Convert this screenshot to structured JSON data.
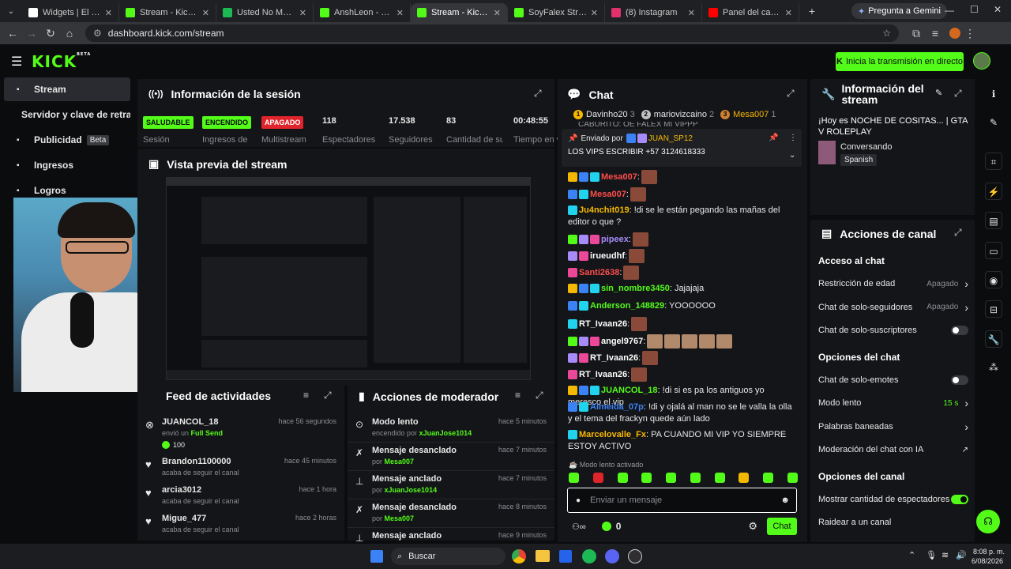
{
  "browser": {
    "tabs": [
      {
        "title": "Widgets | El mejor sof",
        "color": "#ffffff"
      },
      {
        "title": "Stream - Kick Dashbo",
        "color": "#53fc18"
      },
      {
        "title": "Usted No Me Olvid",
        "color": "#1db954"
      },
      {
        "title": "AnshLeon - Watch clip",
        "color": "#53fc18"
      },
      {
        "title": "Stream - Kick Dashbo",
        "color": "#53fc18",
        "active": true
      },
      {
        "title": "SoyFalex Stream - Wa",
        "color": "#53fc18"
      },
      {
        "title": "(8) Instagram",
        "color": "#e1306c"
      },
      {
        "title": "Panel del canal - You",
        "color": "#ff0000"
      }
    ],
    "gemini_label": "Pregunta a Gemini",
    "url": "dashboard.kick.com/stream"
  },
  "header": {
    "logo": "KICK",
    "logo_sup": "BETA",
    "start_stream": "Inicia la transmisión en directo"
  },
  "sidebar": {
    "items": [
      {
        "label": "Stream",
        "icon": "broadcast-icon"
      },
      {
        "label": "Servidor y clave de retransm",
        "icon": ""
      },
      {
        "label": "Publicidad",
        "icon": "ads-icon",
        "badge": "Beta"
      },
      {
        "label": "Ingresos",
        "icon": "chart-icon"
      },
      {
        "label": "Logros",
        "icon": "trophy-icon"
      }
    ]
  },
  "session": {
    "title": "Información de la sesión",
    "stats": [
      {
        "value": "SALUDABLE",
        "label": "Sesión",
        "color": "#53fc18"
      },
      {
        "value": "ENCENDIDO",
        "label": "Ingresos de",
        "color": "#53fc18"
      },
      {
        "value": "APAGADO",
        "label": "Multistream",
        "color": "#e0242b"
      },
      {
        "value": "118",
        "label": "Espectadores"
      },
      {
        "value": "17.538",
        "label": "Seguidores"
      },
      {
        "value": "83",
        "label": "Cantidad de suscripciones"
      },
      {
        "value": "00:48:55",
        "label": "Tiempo en vivo"
      }
    ]
  },
  "preview": {
    "title": "Vista previa del stream"
  },
  "feed": {
    "title": "Feed de actividades",
    "items": [
      {
        "name": "JUANCOL_18",
        "action_prefix": "envió un",
        "action_highlight": "Full Send",
        "time": "hace 56 segundos",
        "amount": "100",
        "icon": "kick-coin-icon"
      },
      {
        "name": "Brandon1100000",
        "action_prefix": "acaba de seguir el canal",
        "action_highlight": "",
        "time": "hace 45 minutos",
        "icon": "heart-icon"
      },
      {
        "name": "arcia3012",
        "action_prefix": "acaba de seguir el canal",
        "action_highlight": "",
        "time": "hace 1 hora",
        "icon": "heart-icon"
      },
      {
        "name": "Migue_477",
        "action_prefix": "acaba de seguir el canal",
        "action_highlight": "",
        "time": "hace 2 horas",
        "icon": "heart-icon"
      }
    ]
  },
  "modactions": {
    "title": "Acciones de moderador",
    "items": [
      {
        "action": "Modo lento",
        "detail_prefix": "encendido por",
        "by": "xJuanJose1014",
        "time": "hace 5 minutos",
        "icon": "slow-mode-icon"
      },
      {
        "action": "Mensaje desanclado",
        "detail_prefix": "por",
        "by": "Mesa007",
        "time": "hace 7 minutos",
        "icon": "unpin-icon"
      },
      {
        "action": "Mensaje anclado",
        "detail_prefix": "por",
        "by": "xJuanJose1014",
        "time": "hace 7 minutos",
        "icon": "pin-icon"
      },
      {
        "action": "Mensaje desanclado",
        "detail_prefix": "por",
        "by": "Mesa007",
        "time": "hace 8 minutos",
        "icon": "unpin-icon"
      },
      {
        "action": "Mensaje anclado",
        "detail_prefix": "",
        "by": "",
        "time": "hace 9 minutos",
        "icon": "pin-icon"
      }
    ]
  },
  "chat": {
    "title": "Chat",
    "top_gifters": [
      {
        "rank": "1",
        "name": "Davinho20",
        "count": "3",
        "color": "#f5b800"
      },
      {
        "rank": "2",
        "name": "mariovizcaino",
        "count": "2",
        "color": "#c0c0c0"
      },
      {
        "rank": "3",
        "name": "Mesa007",
        "count": "1",
        "color": "#cd7f32"
      }
    ],
    "pinned_by_label": "Enviado por",
    "pinned_by": "JUAN_SP12",
    "pinned_message": "LOS VIPS ESCRIBIR +57 3124618333",
    "partial_top": "CABURITO: OE FALEX MI VIPPP",
    "messages": [
      {
        "user": "Mesa007",
        "color": "#ff4d4d",
        "text": ":",
        "emotes": 1
      },
      {
        "user": "Mesa007",
        "color": "#ff4d4d",
        "text": ":",
        "emotes": 1
      },
      {
        "user": "Ju4nchit019",
        "color": "#f5b800",
        "text": ": !di se le están pegando las mañas del editor o que ?",
        "emotes": 0
      },
      {
        "user": "pipeex",
        "color": "#a78bfa",
        "text": ":",
        "emotes": 1
      },
      {
        "user": "irueudhf",
        "color": "#ffffff",
        "text": ":",
        "emotes": 1
      },
      {
        "user": "Santi2638",
        "color": "#ff4d4d",
        "text": ":",
        "emotes": 1
      },
      {
        "user": "sin_nombre3450",
        "color": "#53fc18",
        "text": ": Jajajaja",
        "emotes": 0
      },
      {
        "user": "Anderson_148829",
        "color": "#53fc18",
        "text": ": YOOOOOO",
        "emotes": 0
      },
      {
        "user": "RT_Ivaan26",
        "color": "#ffffff",
        "text": ":",
        "emotes": 1
      },
      {
        "user": "angel9767",
        "color": "#ffffff",
        "text": ":",
        "emotes": 5
      },
      {
        "user": "RT_Ivaan26",
        "color": "#ffffff",
        "text": ":",
        "emotes": 1
      },
      {
        "user": "RT_Ivaan26",
        "color": "#ffffff",
        "text": ":",
        "emotes": 1
      },
      {
        "user": "JUANCOL_18",
        "color": "#53fc18",
        "text": ": !di si es pa los antiguos yo meresco el vip",
        "emotes": 0
      },
      {
        "user": "Almeida_07p",
        "color": "#3b82f6",
        "text": ": !di y ojalá al man no se le valla la olla y el tema del frackyn quede aún lado",
        "emotes": 0
      },
      {
        "user": "Marcelovalle_Fx",
        "color": "#f5b800",
        "text": ": PA CUANDO MI VIP YO SIEMPRE ESTOY ACTIVO",
        "emotes": 0
      }
    ],
    "slow_mode_notice": "Modo lento activado",
    "input_placeholder": "Enviar un mensaje",
    "points": "0",
    "send_label": "Chat"
  },
  "stream_info": {
    "title": "Información del stream",
    "stream_title": "¡Hoy es NOCHE DE COSITAS... | GTA V ROLEPLAY",
    "category": "Conversando",
    "language": "Spanish"
  },
  "channel_actions": {
    "title": "Acciones de canal",
    "sections": [
      {
        "heading": "Acceso al chat",
        "rows": [
          {
            "label": "Restricción de edad",
            "value": "Apagado",
            "kind": "arrow"
          },
          {
            "label": "Chat de solo-seguidores",
            "value": "Apagado",
            "kind": "arrow"
          },
          {
            "label": "Chat de solo-suscriptores",
            "value": "",
            "kind": "toggle-off"
          }
        ]
      },
      {
        "heading": "Opciones del chat",
        "rows": [
          {
            "label": "Chat de solo-emotes",
            "value": "",
            "kind": "toggle-off"
          },
          {
            "label": "Modo lento",
            "value": "15 s",
            "kind": "arrow"
          },
          {
            "label": "Palabras baneadas",
            "value": "",
            "kind": "arrow"
          },
          {
            "label": "Moderación del chat con IA",
            "value": "",
            "kind": "external"
          }
        ]
      },
      {
        "heading": "Opciones del canal",
        "rows": [
          {
            "label": "Mostrar cantidad de espectadores",
            "value": "",
            "kind": "toggle-on"
          },
          {
            "label": "Raidear a un canal",
            "value": "",
            "kind": "none"
          }
        ]
      }
    ]
  },
  "taskbar": {
    "search_placeholder": "Buscar",
    "time": "8:08 p. m.",
    "date": "6/08/2026"
  },
  "colors": {
    "accent": "#53fc18",
    "panel": "#141518",
    "bg": "#0b0c0e"
  }
}
